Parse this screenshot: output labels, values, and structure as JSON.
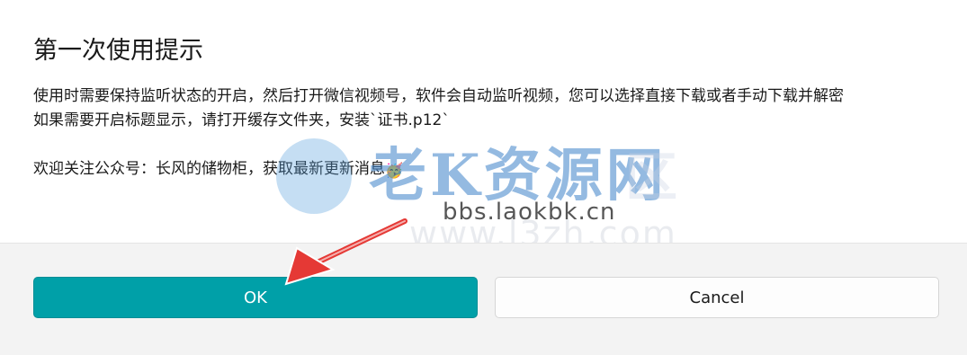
{
  "dialog": {
    "title": "第一次使用提示",
    "lines": [
      "使用时需要保持监听状态的开启，然后打开微信视频号，软件会自动监听视频，您可以选择直接下载或者手动下载并解密",
      "如果需要开启标题显示，请打开缓存文件夹，安装`证书.p12`",
      "",
      "欢迎关注公众号：长风的储物柜，获取最新更新消息"
    ],
    "emoji": "🥳",
    "ok_label": "OK",
    "cancel_label": "Cancel"
  },
  "watermark": {
    "brand": "老K资源网",
    "ghost": "区",
    "url": "bbs.laokbk.cn",
    "url_ghost": "www.l3zh.com"
  },
  "colors": {
    "ok_button": "#00a0a8",
    "footer_bg": "#f3f3f3",
    "arrow": "#e53935"
  }
}
